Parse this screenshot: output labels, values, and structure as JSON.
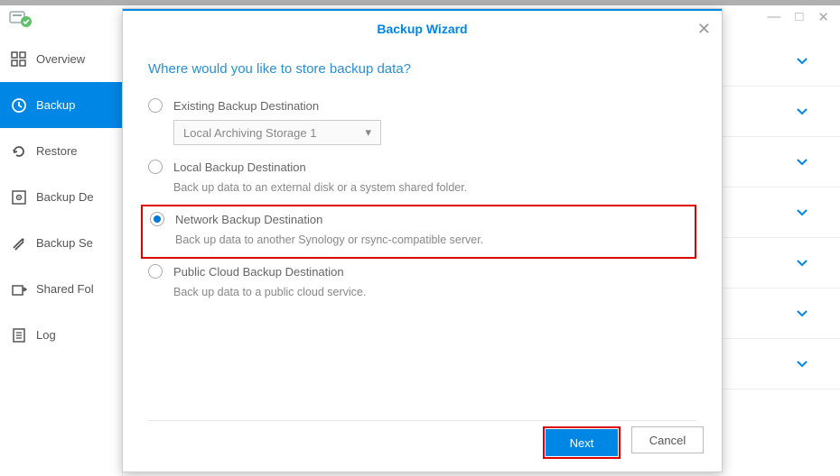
{
  "window": {
    "minimize": "—",
    "maximize": "□",
    "close": "✕"
  },
  "sidebar": {
    "items": [
      {
        "label": "Overview"
      },
      {
        "label": "Backup"
      },
      {
        "label": "Restore"
      },
      {
        "label": "Backup De"
      },
      {
        "label": "Backup Se"
      },
      {
        "label": "Shared Fol"
      },
      {
        "label": "Log"
      }
    ]
  },
  "modal": {
    "title": "Backup Wizard",
    "question": "Where would you like to store backup data?",
    "dropdown_value": "Local Archiving Storage 1",
    "options": [
      {
        "label": "Existing Backup Destination",
        "desc": ""
      },
      {
        "label": "Local Backup Destination",
        "desc": "Back up data to an external disk or a system shared folder."
      },
      {
        "label": "Network Backup Destination",
        "desc": "Back up data to another Synology or rsync-compatible server."
      },
      {
        "label": "Public Cloud Backup Destination",
        "desc": "Back up data to a public cloud service."
      }
    ],
    "next": "Next",
    "cancel": "Cancel"
  }
}
